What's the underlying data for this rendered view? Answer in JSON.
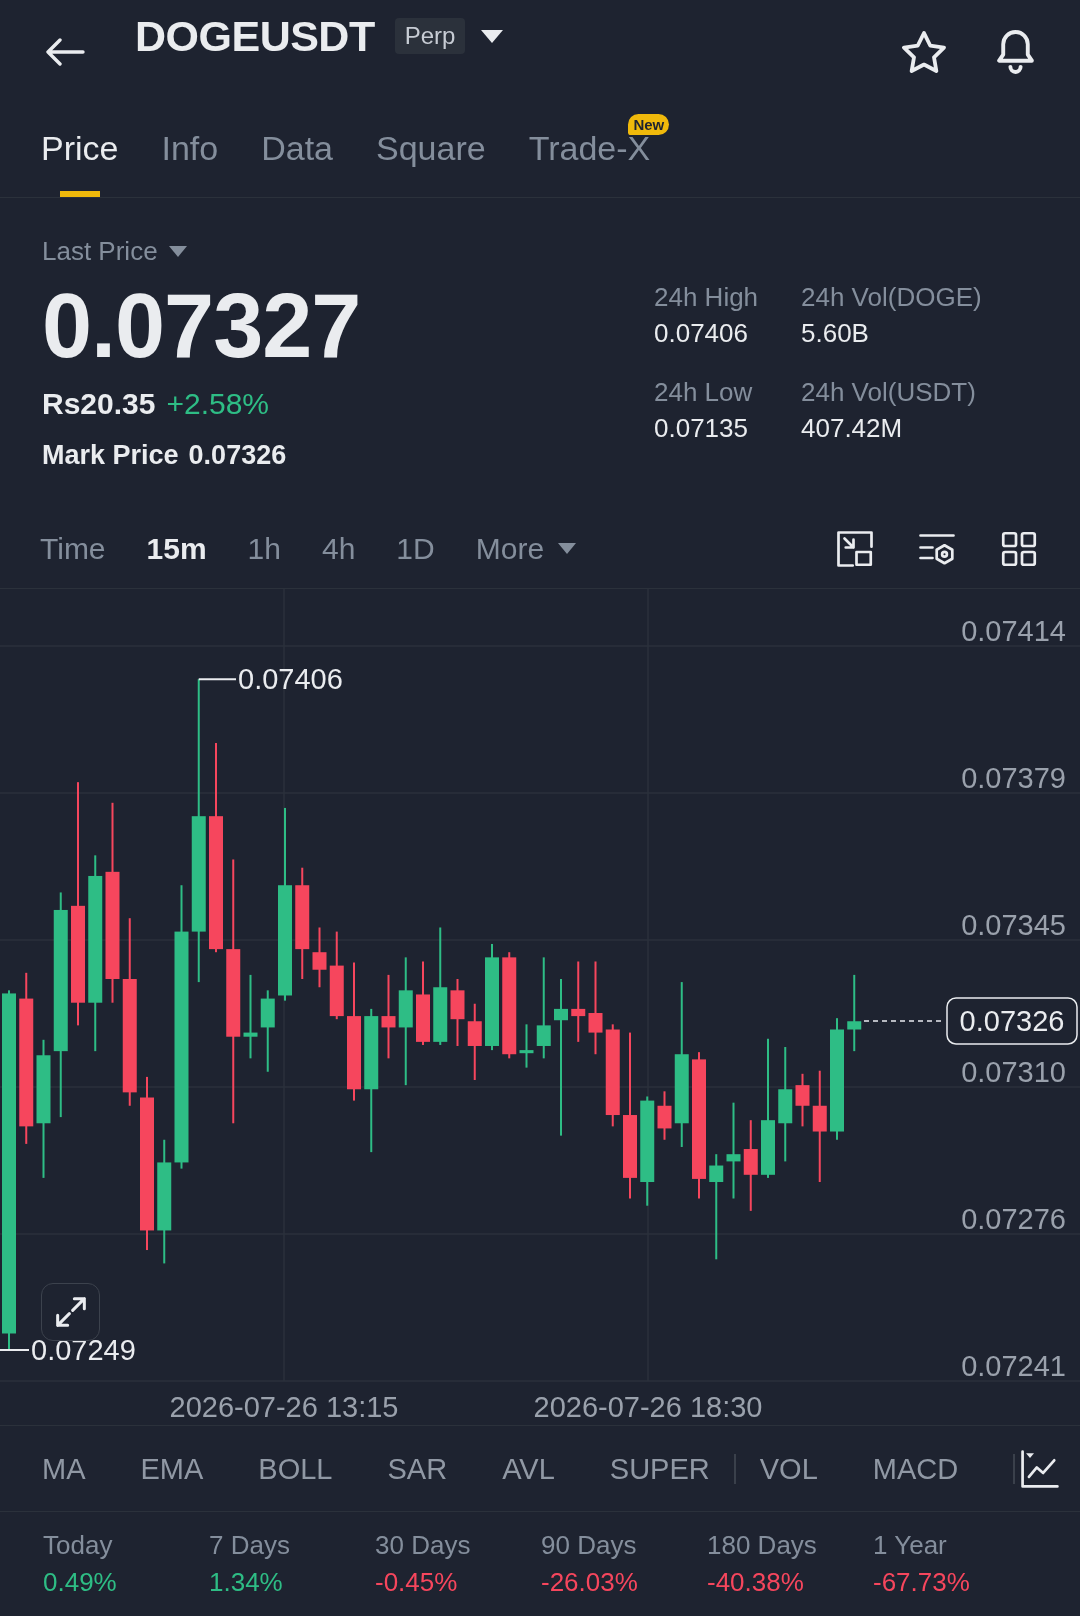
{
  "header": {
    "title": "DOGEUSDT",
    "badge": "Perp"
  },
  "tabs": [
    {
      "label": "Price",
      "selected": true
    },
    {
      "label": "Info",
      "selected": false
    },
    {
      "label": "Data",
      "selected": false
    },
    {
      "label": "Square",
      "selected": false
    },
    {
      "label": "Trade-X",
      "selected": false,
      "badge": "New"
    }
  ],
  "price": {
    "label": "Last Price",
    "value": "0.07327",
    "fiat": "Rs20.35",
    "change": "+2.58%",
    "color": "#2ebd85",
    "mark_label": "Mark Price",
    "mark_value": "0.07326"
  },
  "stats": [
    {
      "label": "24h High",
      "value": "0.07406"
    },
    {
      "label": "24h Vol(DOGE)",
      "value": "5.60B"
    },
    {
      "label": "24h Low",
      "value": "0.07135"
    },
    {
      "label": "24h Vol(USDT)",
      "value": "407.42M"
    }
  ],
  "intervals": [
    {
      "label": "Time",
      "selected": false,
      "dropdown": false
    },
    {
      "label": "15m",
      "selected": true,
      "dropdown": false
    },
    {
      "label": "1h",
      "selected": false,
      "dropdown": false
    },
    {
      "label": "4h",
      "selected": false,
      "dropdown": false
    },
    {
      "label": "1D",
      "selected": false,
      "dropdown": false
    },
    {
      "label": "More",
      "selected": false,
      "dropdown": true
    }
  ],
  "chart": {
    "price_scale": [
      "0.07414",
      "0.07379",
      "0.07345",
      "0.07310",
      "0.07276",
      "0.07241"
    ],
    "time_axis": [
      "2026-07-26 13:15",
      "2026-07-26 18:30"
    ],
    "high_label": "0.07406",
    "low_label": "0.07249",
    "last_price_tag": "0.07326"
  },
  "indicators": {
    "main": [
      {
        "label": "MA",
        "selected": false
      },
      {
        "label": "EMA",
        "selected": false
      },
      {
        "label": "BOLL",
        "selected": false
      },
      {
        "label": "SAR",
        "selected": false
      },
      {
        "label": "AVL",
        "selected": false
      },
      {
        "label": "SUPER",
        "selected": false
      }
    ],
    "sub": [
      {
        "label": "VOL",
        "selected": false
      },
      {
        "label": "MACD",
        "selected": false
      }
    ]
  },
  "performance": [
    {
      "period": "Today",
      "change": "0.49%",
      "color": "#2ebd85"
    },
    {
      "period": "7 Days",
      "change": "1.34%",
      "color": "#2ebd85"
    },
    {
      "period": "30 Days",
      "change": "-0.45%",
      "color": "#f6465d"
    },
    {
      "period": "90 Days",
      "change": "-26.03%",
      "color": "#f6465d"
    },
    {
      "period": "180 Days",
      "change": "-40.38%",
      "color": "#f6465d"
    },
    {
      "period": "1 Year",
      "change": "-67.73%",
      "color": "#f6465d"
    }
  ]
}
